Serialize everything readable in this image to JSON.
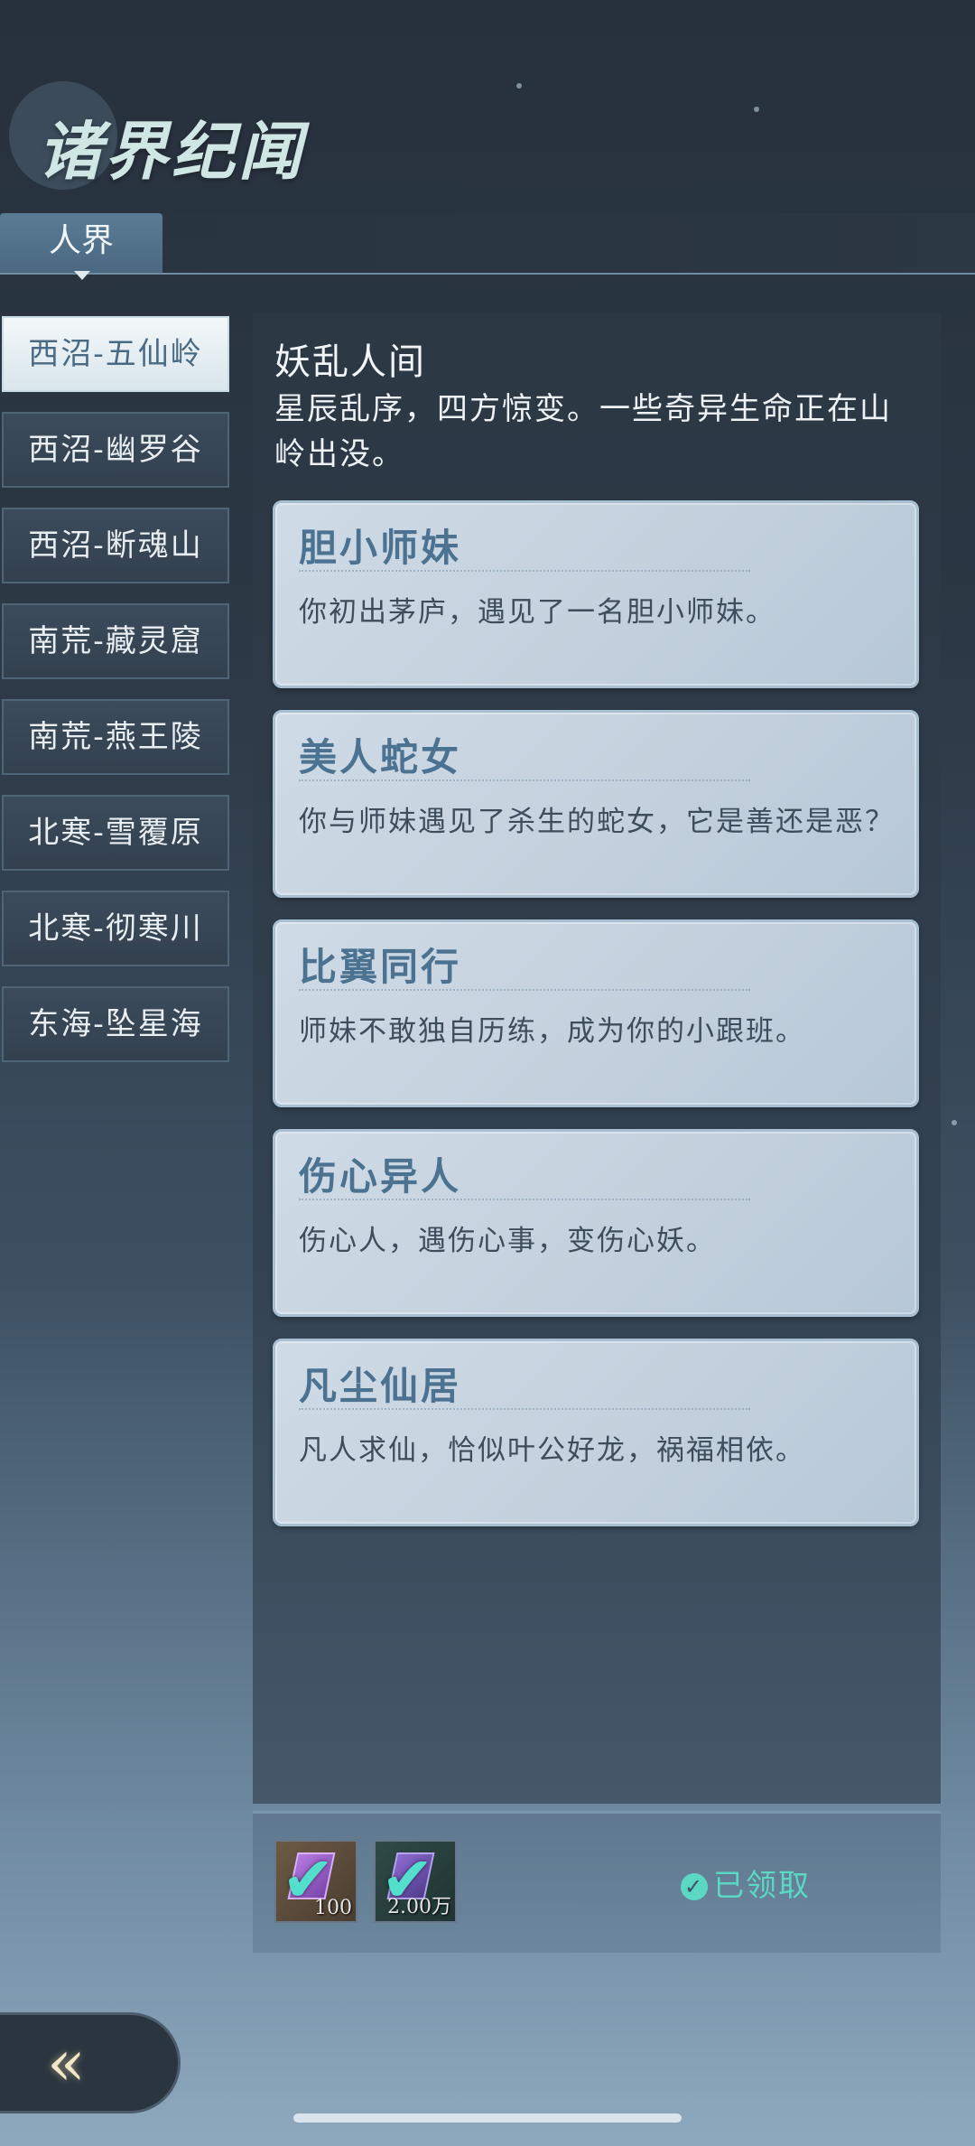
{
  "header": {
    "title": "诸界纪闻",
    "tab_label": "人界"
  },
  "sidebar": {
    "items": [
      {
        "label": "西沼-五仙岭",
        "active": true
      },
      {
        "label": "西沼-幽罗谷",
        "active": false
      },
      {
        "label": "西沼-断魂山",
        "active": false
      },
      {
        "label": "南荒-藏灵窟",
        "active": false
      },
      {
        "label": "南荒-燕王陵",
        "active": false
      },
      {
        "label": "北寒-雪覆原",
        "active": false
      },
      {
        "label": "北寒-彻寒川",
        "active": false
      },
      {
        "label": "东海-坠星海",
        "active": false
      }
    ]
  },
  "main": {
    "title": "妖乱人间",
    "description": "星辰乱序，四方惊变。一些奇异生命正在山岭出没。",
    "cards": [
      {
        "title": "胆小师妹",
        "desc": "你初出茅庐，遇见了一名胆小师妹。"
      },
      {
        "title": "美人蛇女",
        "desc": "你与师妹遇见了杀生的蛇女，它是善还是恶？"
      },
      {
        "title": "比翼同行",
        "desc": "师妹不敢独自历练，成为你的小跟班。"
      },
      {
        "title": "伤心异人",
        "desc": "伤心人，遇伤心事，变伤心妖。"
      },
      {
        "title": "凡尘仙居",
        "desc": "凡人求仙，恰似叶公好龙，祸福相依。"
      }
    ]
  },
  "rewards": {
    "items": [
      {
        "count": "100",
        "icon": "purple-crystal-icon"
      },
      {
        "count": "2.00万",
        "icon": "spirit-stone-icon"
      }
    ],
    "status": "已领取"
  },
  "colors": {
    "accent": "#5bd8c4",
    "card_title": "#4c7291"
  }
}
